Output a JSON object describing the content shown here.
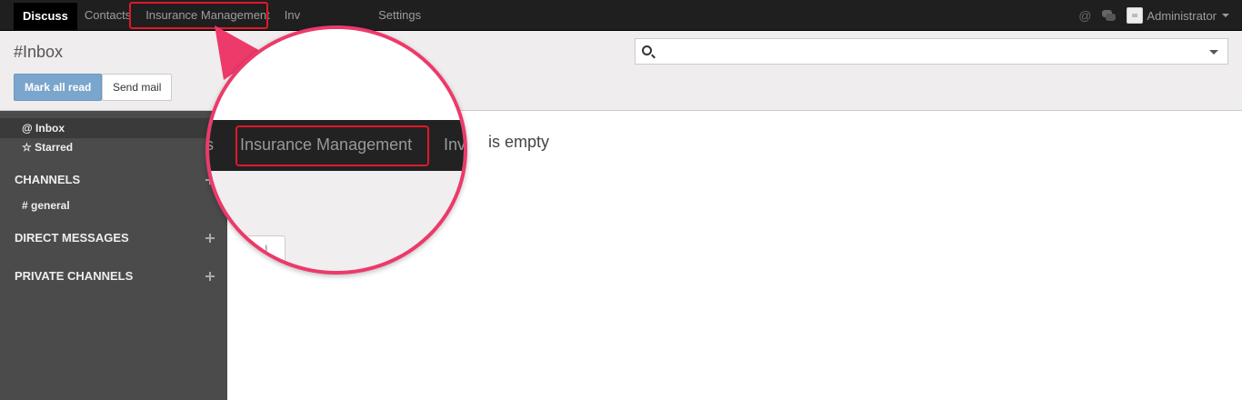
{
  "topbar": {
    "menu": [
      {
        "label": "Discuss",
        "active": true
      },
      {
        "label": "Contacts"
      },
      {
        "label": "Insurance Management"
      },
      {
        "label": "Inv"
      },
      {
        "label": ""
      },
      {
        "label": "Settings"
      }
    ],
    "user_name": "Administrator",
    "at_icon": "@"
  },
  "control_panel": {
    "breadcrumb": "#Inbox",
    "mark_all_read": "Mark all read",
    "send_mail": "Send mail",
    "search_placeholder": ""
  },
  "sidebar": {
    "inbox": "@ Inbox",
    "starred": "☆ Starred",
    "channels_header": "CHANNELS",
    "general": "# general",
    "direct_messages_header": "DIRECT MESSAGES",
    "private_channels_header": "PRIVATE CHANNELS"
  },
  "main": {
    "empty_message": "is empty"
  },
  "magnifier": {
    "left_fragment": "s",
    "highlighted": "Insurance Management",
    "right_fragment": "Inv",
    "button_fragment": "l"
  },
  "colors": {
    "highlight": "#e0182a",
    "callout": "#ec3a6a"
  }
}
